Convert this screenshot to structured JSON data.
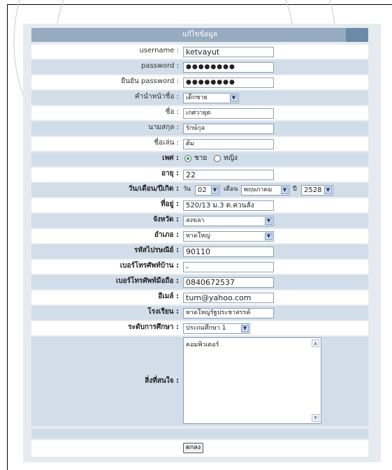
{
  "header": {
    "title": "แก้ไขข้อมูล"
  },
  "labels": {
    "username": "username :",
    "password": "password :",
    "confirm_password": "ยืนยัน password :",
    "prefix": "คำนำหน้าชื่อ :",
    "first_name": "ชื่อ :",
    "last_name": "นามสกุล :",
    "nickname": "ชื่อเล่น :",
    "gender": "เพศ :",
    "age": "อายุ :",
    "birthdate": "วัน/เดือน/ปีเกิด :",
    "address": "ที่อยู่ :",
    "province": "จังหวัด :",
    "district": "อำเภอ :",
    "postcode": "รหัสไปรษณีย์ :",
    "home_phone": "เบอร์โทรศัพท์บ้าน :",
    "mobile_phone": "เบอร์โทรศัพท์มือถือ :",
    "email": "อีเมล์ :",
    "school": "โรงเรียน :",
    "education_level": "ระดับการศึกษา :",
    "interests": "สิ่งที่สนใจ :"
  },
  "values": {
    "username": "ketvayut",
    "password": "●●●●●●●●",
    "confirm_password": "●●●●●●●●",
    "prefix": "เด็กชาย",
    "first_name": "เกศวายุต",
    "last_name": "รักษ์กุล",
    "nickname": "ต้ม",
    "gender_male": "ชาย",
    "gender_female": "หญิง",
    "age": "22",
    "day_prefix": "วัน",
    "day": "02",
    "month_prefix": "เดือน",
    "month": "พฤษภาคม",
    "year_prefix": "ปี",
    "year": "2528",
    "address": "520/13 ม.3 ต.ควนลัง",
    "province": "สงขลา",
    "district": "หาดใหญ่",
    "postcode": "90110",
    "home_phone": "-",
    "mobile_phone": "0840672537",
    "email": "tum@yahoo.com",
    "school": "หาดใหญ่รัฐประชาสรรค์",
    "education_level": "ประถมศึกษา 1",
    "interests": "คอมพิวเตอร์"
  },
  "buttons": {
    "submit": "ตกลง"
  },
  "icons": {
    "dropdown": "chevron-down-icon",
    "scroll_up": "scroll-up-icon",
    "scroll_down": "scroll-down-icon"
  },
  "colors": {
    "panel": "#e6ebef",
    "header": "#96abbf",
    "header_tab": "#6c8aa6",
    "row_alt": "#ffffff",
    "row_blue": "#d1dde8"
  }
}
